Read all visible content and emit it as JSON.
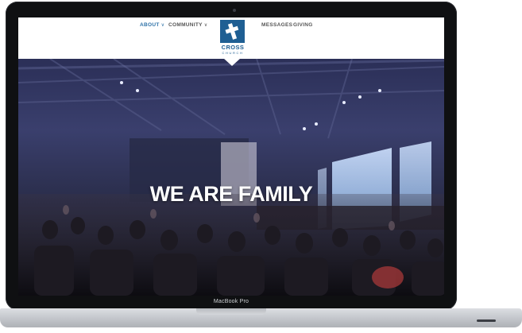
{
  "nav": {
    "left_items": [
      {
        "label": "ABOUT",
        "chevron": "∨",
        "active": true
      },
      {
        "label": "COMMUNITY",
        "chevron": "∨",
        "active": false
      }
    ],
    "right_items": [
      {
        "label": "MESSAGES"
      },
      {
        "label": "GIVING"
      }
    ],
    "logo": {
      "name": "CROSS",
      "sub": "CHURCH",
      "icon": "cross-icon",
      "color": "#1f5f93"
    },
    "active_color": "#2e72a8"
  },
  "hero": {
    "title": "WE ARE FAMILY"
  },
  "device": {
    "label": "MacBook Pro"
  }
}
